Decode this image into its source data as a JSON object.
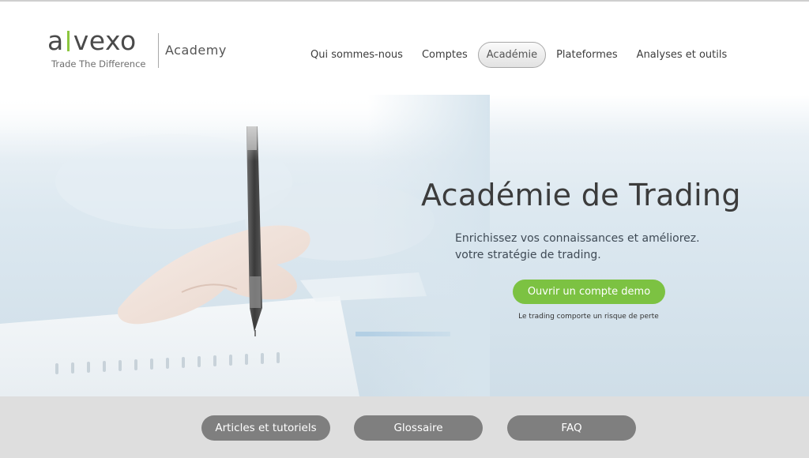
{
  "header": {
    "logo_word_left": "a",
    "logo_word_right": "vexo",
    "logo_tagline": "Trade The Difference",
    "logo_section": "Academy",
    "nav": [
      {
        "label": "Qui sommes-nous"
      },
      {
        "label": "Comptes"
      },
      {
        "label": "Académie",
        "active": true
      },
      {
        "label": "Plateformes"
      },
      {
        "label": "Analyses et outils"
      }
    ]
  },
  "hero": {
    "title": "Académie de Trading",
    "subtitle_line1": "Enrichissez vos connaissances et améliorez.",
    "subtitle_line2": "votre stratégie de trading.",
    "cta_label": "Ouvrir un compte demo",
    "risk_note": "Le trading comporte un risque de perte"
  },
  "footer": {
    "buttons": [
      {
        "label": "Articles et tutoriels"
      },
      {
        "label": "Glossaire"
      },
      {
        "label": "FAQ"
      }
    ]
  },
  "colors": {
    "accent_green": "#7cc242",
    "footer_button": "#7f7f7f",
    "footer_bg": "#dedede"
  }
}
